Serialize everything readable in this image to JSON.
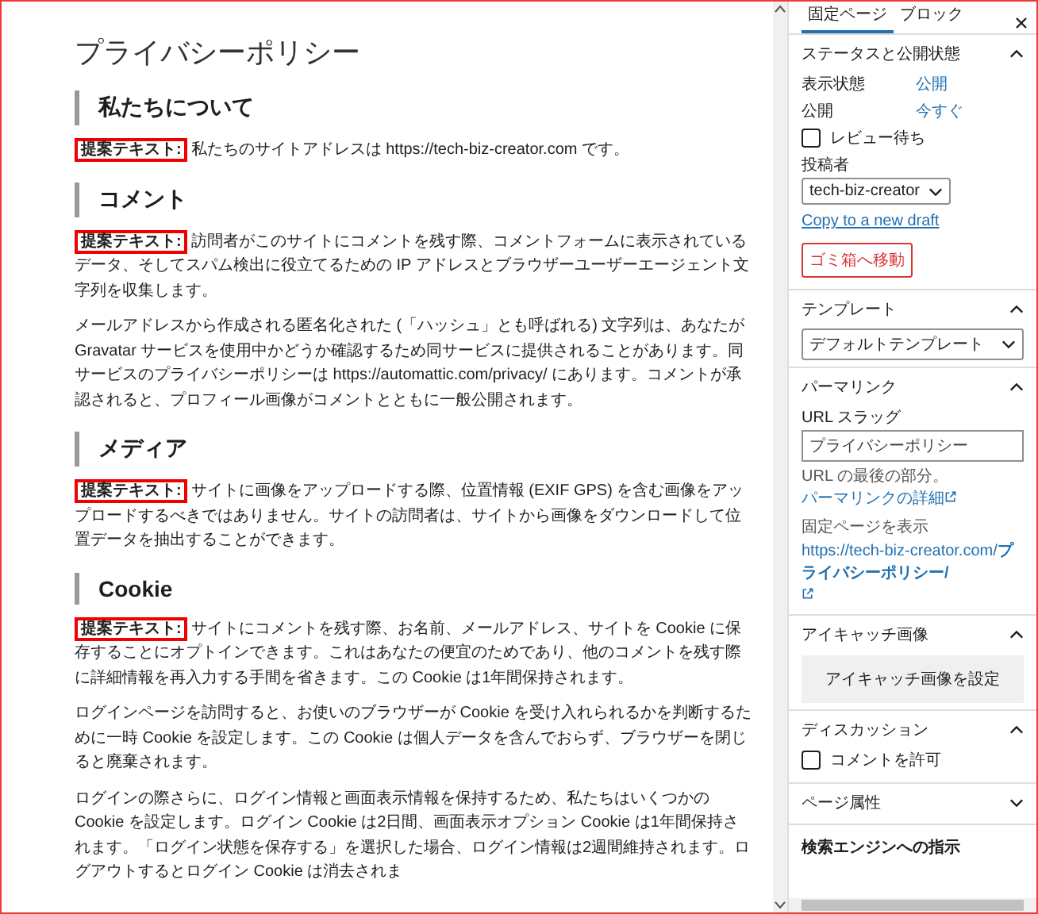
{
  "editor": {
    "title": "プライバシーポリシー",
    "sections": [
      {
        "heading": "私たちについて",
        "paragraphs": [
          {
            "label": "提案テキスト:",
            "text": "私たちのサイトアドレスは https://tech-biz-creator.com です。"
          }
        ]
      },
      {
        "heading": "コメント",
        "paragraphs": [
          {
            "label": "提案テキスト:",
            "text": "訪問者がこのサイトにコメントを残す際、コメントフォームに表示されているデータ、そしてスパム検出に役立てるための IP アドレスとブラウザーユーザーエージェント文字列を収集します。"
          },
          {
            "text": "メールアドレスから作成される匿名化された (「ハッシュ」とも呼ばれる) 文字列は、あなたが Gravatar サービスを使用中かどうか確認するため同サービスに提供されることがあります。同サービスのプライバシーポリシーは https://automattic.com/privacy/ にあります。コメントが承認されると、プロフィール画像がコメントとともに一般公開されます。"
          }
        ]
      },
      {
        "heading": "メディア",
        "paragraphs": [
          {
            "label": "提案テキスト:",
            "text": "サイトに画像をアップロードする際、位置情報 (EXIF GPS) を含む画像をアップロードするべきではありません。サイトの訪問者は、サイトから画像をダウンロードして位置データを抽出することができます。"
          }
        ]
      },
      {
        "heading": "Cookie",
        "paragraphs": [
          {
            "label": "提案テキスト:",
            "text": "サイトにコメントを残す際、お名前、メールアドレス、サイトを Cookie に保存することにオプトインできます。これはあなたの便宜のためであり、他のコメントを残す際に詳細情報を再入力する手間を省きます。この Cookie は1年間保持されます。"
          },
          {
            "text": "ログインページを訪問すると、お使いのブラウザーが Cookie を受け入れられるかを判断するために一時 Cookie を設定します。この Cookie は個人データを含んでおらず、ブラウザーを閉じると廃棄されます。"
          },
          {
            "text": "ログインの際さらに、ログイン情報と画面表示情報を保持するため、私たちはいくつかの Cookie を設定します。ログイン Cookie は2日間、画面表示オプション Cookie は1年間保持されます。「ログイン状態を保存する」を選択した場合、ログイン情報は2週間維持されます。ログアウトするとログイン Cookie は消去されま"
          }
        ]
      }
    ]
  },
  "sidebar": {
    "tabs": [
      {
        "label": "固定ページ",
        "selected": true
      },
      {
        "label": "ブロック",
        "selected": false
      }
    ],
    "panels": [
      {
        "title": "ステータスと公開状態",
        "expanded": true,
        "items": [
          {
            "kind": "field",
            "label": "表示状態",
            "value": "公開"
          },
          {
            "kind": "field",
            "label": "公開",
            "value": "今すぐ"
          },
          {
            "kind": "checkbox",
            "label": "レビュー待ち",
            "checked": false
          },
          {
            "kind": "select",
            "label": "投稿者",
            "value": "tech-biz-creator"
          },
          {
            "kind": "link",
            "text": "Copy to a new draft"
          },
          {
            "kind": "danger_button",
            "text": "ゴミ箱へ移動"
          }
        ]
      },
      {
        "title": "テンプレート",
        "expanded": true,
        "items": [
          {
            "kind": "select",
            "value": "デフォルトテンプレート"
          }
        ]
      },
      {
        "title": "パーマリンク",
        "expanded": true,
        "items": [
          {
            "kind": "input",
            "label": "URL スラッグ",
            "value": "プライバシーポリシー"
          },
          {
            "kind": "help",
            "text": "URL の最後の部分。",
            "link": "パーマリンクの詳細"
          },
          {
            "kind": "caption",
            "text": "固定ページを表示"
          },
          {
            "kind": "url",
            "text": "https://tech-biz-creator.com/**プライバシーポリシー/**"
          }
        ]
      },
      {
        "title": "アイキャッチ画像",
        "expanded": true,
        "items": [
          {
            "kind": "image_button",
            "text": "アイキャッチ画像を設定"
          }
        ]
      },
      {
        "title": "ディスカッション",
        "expanded": true,
        "items": [
          {
            "kind": "checkbox",
            "label": "コメントを許可",
            "checked": false
          }
        ]
      },
      {
        "title": "ページ属性",
        "expanded": false
      }
    ],
    "footer_heading": "検索エンジンへの指示"
  }
}
